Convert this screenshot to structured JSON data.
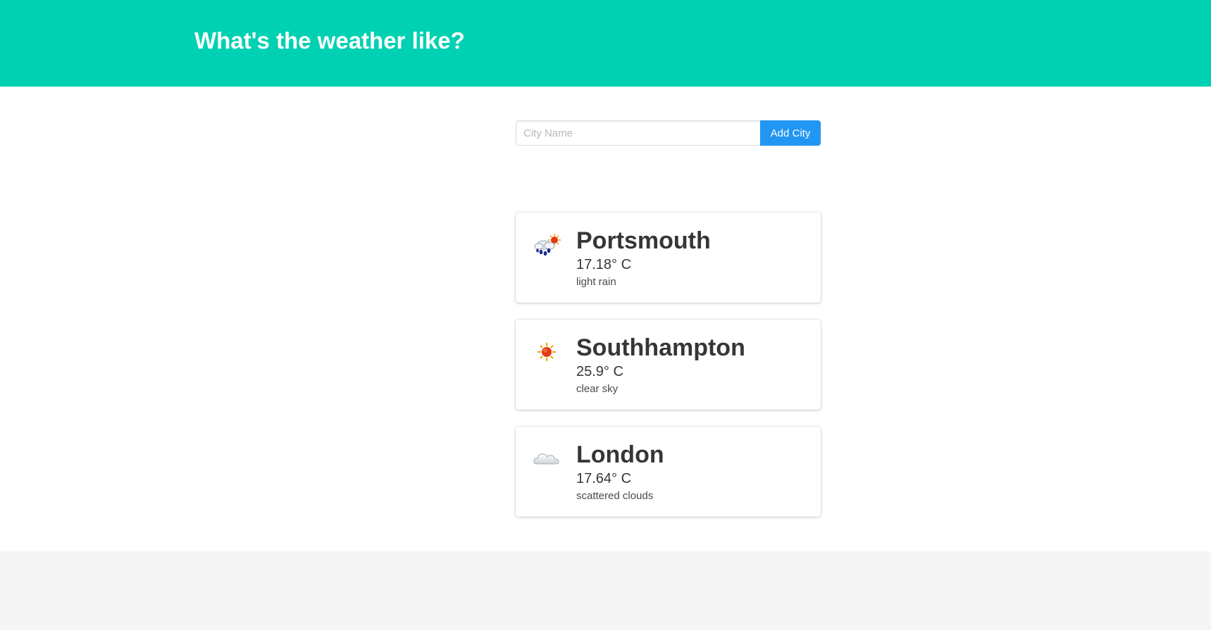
{
  "hero": {
    "title": "What's the weather like?"
  },
  "search": {
    "placeholder": "City Name",
    "value": "",
    "button_label": "Add City"
  },
  "colors": {
    "hero_bg": "#00d1b2",
    "button_bg": "#2196f3",
    "footer_bg": "#f5f5f5"
  },
  "cities": [
    {
      "name": "Portsmouth",
      "temperature": "17.18° C",
      "description": "light rain",
      "icon": "light-rain-sun-icon"
    },
    {
      "name": "Southhampton",
      "temperature": "25.9° C",
      "description": "clear sky",
      "icon": "sun-icon"
    },
    {
      "name": "London",
      "temperature": "17.64° C",
      "description": "scattered clouds",
      "icon": "cloud-icon"
    }
  ]
}
